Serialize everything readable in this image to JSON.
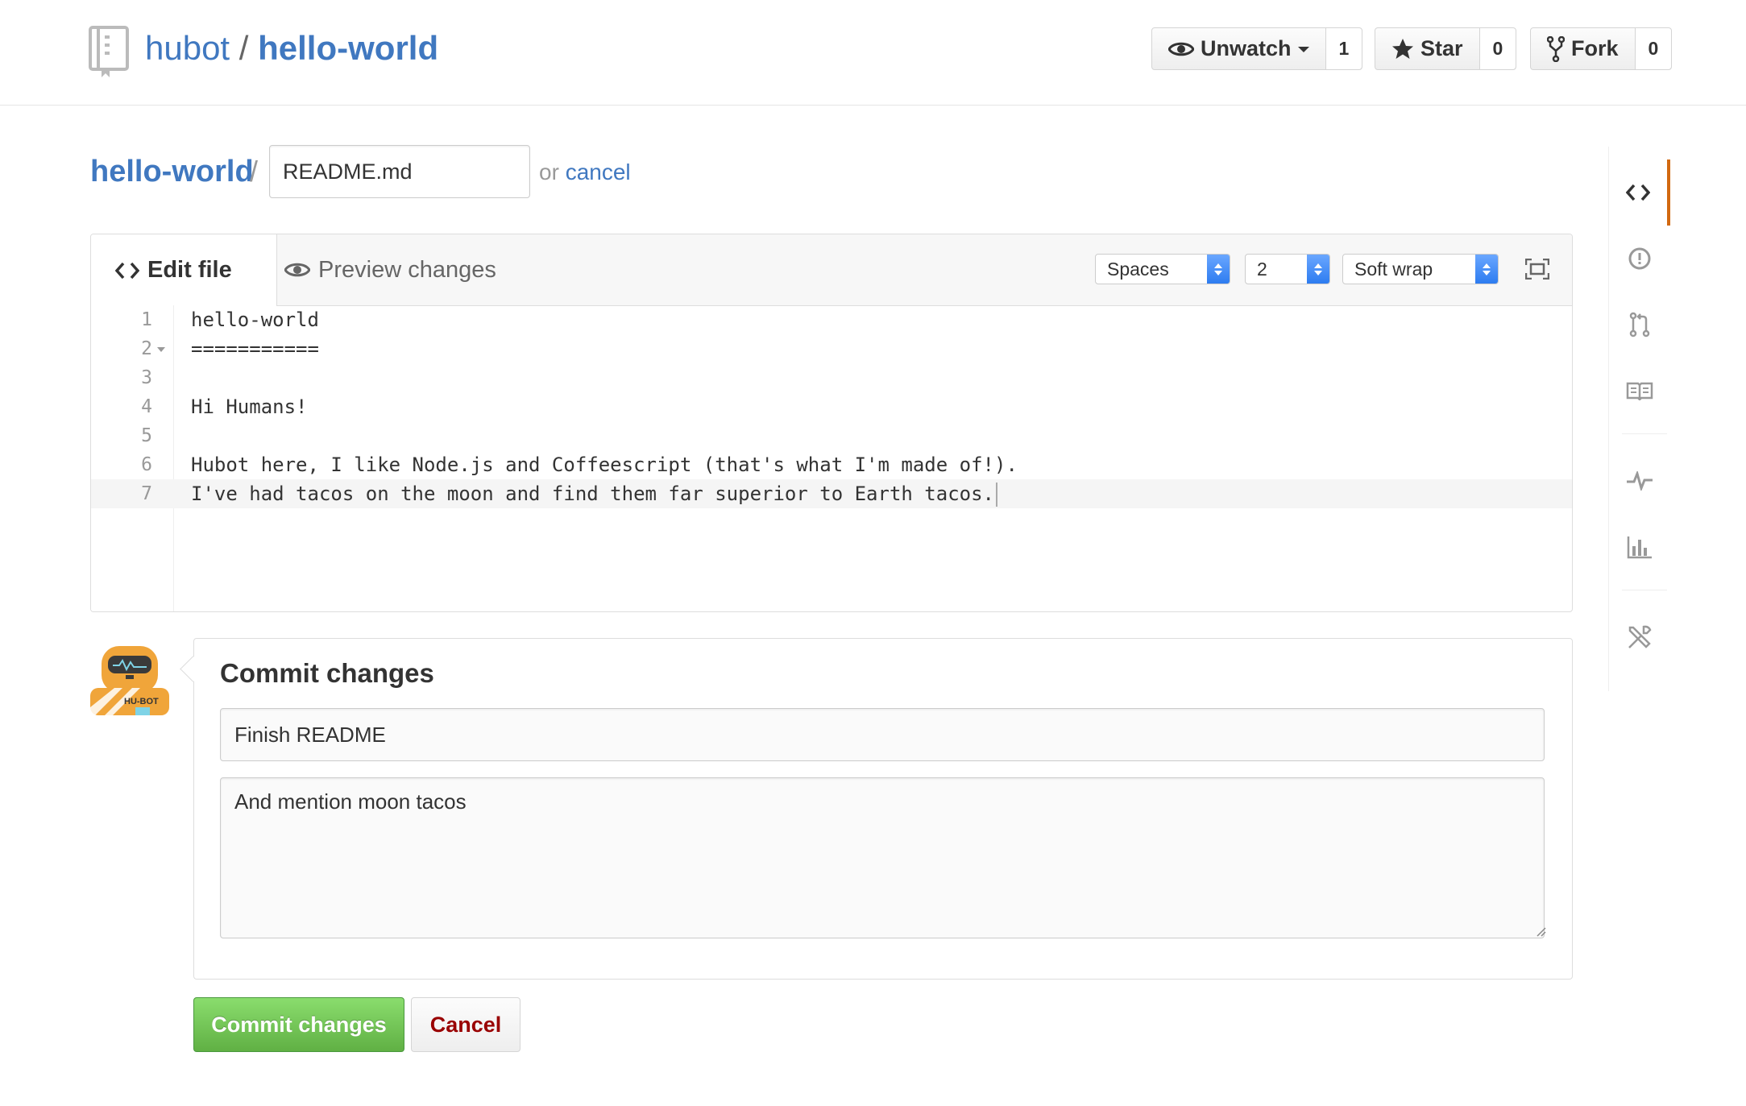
{
  "header": {
    "owner": "hubot",
    "separator": "/",
    "repo": "hello-world",
    "watch_label": "Unwatch",
    "watch_count": "1",
    "star_label": "Star",
    "star_count": "0",
    "fork_label": "Fork",
    "fork_count": "0"
  },
  "breadcrumb": {
    "repo": "hello-world",
    "separator": "/",
    "filename_value": "README.md",
    "or_text": "or",
    "cancel_label": "cancel"
  },
  "editor": {
    "tabs": {
      "edit": "Edit file",
      "preview": "Preview changes"
    },
    "indent_mode": "Spaces",
    "indent_size": "2",
    "wrap_mode": "Soft wrap",
    "lines": [
      {
        "n": "1",
        "text": "hello-world"
      },
      {
        "n": "2",
        "text": "==========="
      },
      {
        "n": "3",
        "text": ""
      },
      {
        "n": "4",
        "text": "Hi Humans!"
      },
      {
        "n": "5",
        "text": ""
      },
      {
        "n": "6",
        "text": "Hubot here, I like Node.js and Coffeescript (that's what I'm made of!)."
      },
      {
        "n": "7",
        "text": "I've had tacos on the moon and find them far superior to Earth tacos."
      }
    ]
  },
  "commit": {
    "title": "Commit changes",
    "summary_value": "Finish README",
    "description_value": "And mention moon tacos",
    "commit_button": "Commit changes",
    "cancel_button": "Cancel"
  },
  "colors": {
    "link": "#4078c0",
    "commit_green": "#60b044",
    "cancel_red": "#990000",
    "nav_active": "#d26911"
  },
  "sidenav": {
    "items": [
      "code-icon",
      "issues-icon",
      "pull-request-icon",
      "wiki-icon",
      "pulse-icon",
      "graphs-icon",
      "settings-icon"
    ]
  }
}
